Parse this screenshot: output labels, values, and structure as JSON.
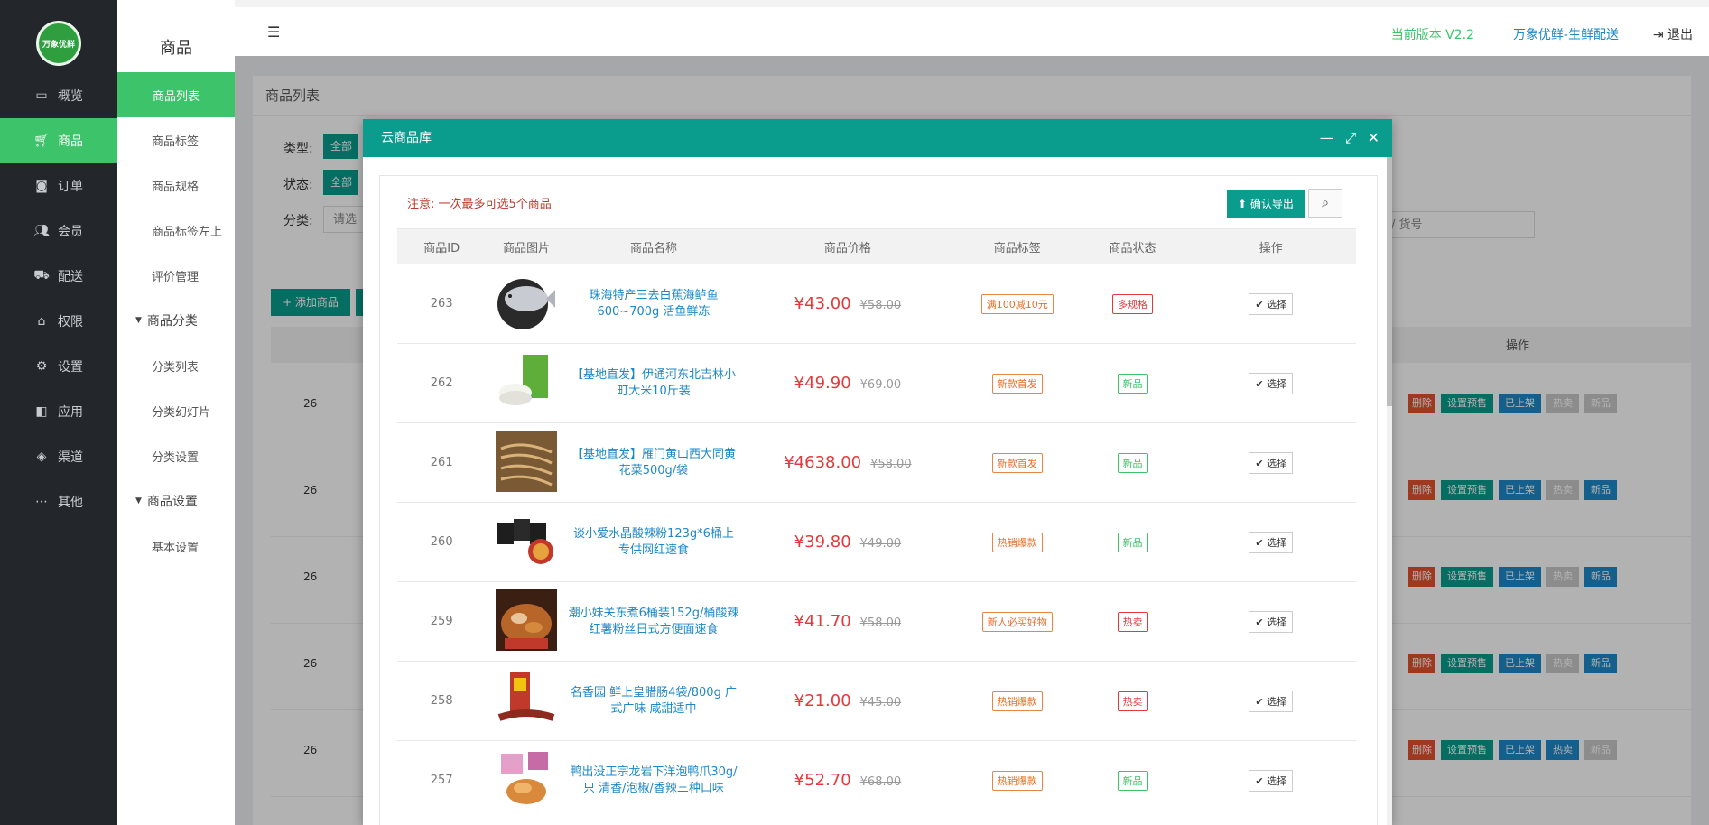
{
  "brand": {
    "logo_text": "万象优鲜"
  },
  "header": {
    "version": "当前版本 V2.2",
    "store": "万象优鲜-生鲜配送",
    "logout": "退出"
  },
  "sidebar": {
    "items": [
      {
        "label": "概览",
        "icon": "monitor-icon"
      },
      {
        "label": "商品",
        "icon": "cart-icon"
      },
      {
        "label": "订单",
        "icon": "money-icon"
      },
      {
        "label": "会员",
        "icon": "users-icon"
      },
      {
        "label": "配送",
        "icon": "truck-icon"
      },
      {
        "label": "权限",
        "icon": "bank-icon"
      },
      {
        "label": "设置",
        "icon": "sitemap-icon"
      },
      {
        "label": "应用",
        "icon": "apps-icon"
      },
      {
        "label": "渠道",
        "icon": "cube-icon"
      },
      {
        "label": "其他",
        "icon": "dots-icon"
      }
    ]
  },
  "subnav": {
    "title": "商品",
    "items": [
      "商品列表",
      "商品标签",
      "商品规格",
      "商品标签左上",
      "评价管理"
    ],
    "group1": "商品分类",
    "group1_items": [
      "分类列表",
      "分类幻灯片",
      "分类设置"
    ],
    "group2": "商品设置",
    "group2_items": [
      "基本设置"
    ]
  },
  "page": {
    "card_title": "商品列表",
    "filter_type": "类型:",
    "filter_status": "状态:",
    "filter_category": "分类:",
    "filter_all": "全部",
    "filter_select": "请选",
    "search_hint": "/ 货号",
    "add_button": "+ 添加商品",
    "op_header": "操作",
    "row_ids": [
      "26",
      "26",
      "26",
      "26",
      "26"
    ],
    "row_buttons": [
      "删除",
      "设置预售",
      "已上架",
      "热卖",
      "新品"
    ]
  },
  "modal": {
    "title": "云商品库",
    "notice": "注意:  一次最多可选5个商品",
    "export_button": "确认导出",
    "columns": [
      "商品ID",
      "商品图片",
      "商品名称",
      "商品价格",
      "商品标签",
      "商品状态",
      "操作"
    ],
    "select_label": "选择",
    "rows": [
      {
        "id": "263",
        "name": "珠海特产三去白蕉海鲈鱼600~700g 活鱼鲜冻",
        "price": "¥43.00",
        "old_price": "¥58.00",
        "tag": "满100减10元",
        "status": "多规格",
        "status_color": "#e4393c"
      },
      {
        "id": "262",
        "name": "【基地直发】伊通河东北吉林小町大米10斤装",
        "price": "¥49.90",
        "old_price": "¥69.00",
        "tag": "新款首发",
        "status": "新品",
        "status_color": "#3dc36a"
      },
      {
        "id": "261",
        "name": "【基地直发】雁门黄山西大同黄花菜500g/袋",
        "price": "¥4638.00",
        "old_price": "¥58.00",
        "tag": "新款首发",
        "status": "新品",
        "status_color": "#3dc36a"
      },
      {
        "id": "260",
        "name": "谈小爱水晶酸辣粉123g*6桶上专供网红速食",
        "price": "¥39.80",
        "old_price": "¥49.00",
        "tag": "热销爆款",
        "status": "新品",
        "status_color": "#3dc36a"
      },
      {
        "id": "259",
        "name": "潮小妹关东煮6桶装152g/桶酸辣红薯粉丝日式方便面速食",
        "price": "¥41.70",
        "old_price": "¥58.00",
        "tag": "新人必买好物",
        "status": "热卖",
        "status_color": "#e4393c"
      },
      {
        "id": "258",
        "name": "名香园 鲜上皇腊肠4袋/800g 广式广味 咸甜适中",
        "price": "¥21.00",
        "old_price": "¥45.00",
        "tag": "热销爆款",
        "status": "热卖",
        "status_color": "#e4393c"
      },
      {
        "id": "257",
        "name": "鸭出没正宗龙岩下洋泡鸭爪30g/只 清香/泡椒/香辣三种口味",
        "price": "¥52.70",
        "old_price": "¥68.00",
        "tag": "热销爆款",
        "status": "新品",
        "status_color": "#3dc36a"
      }
    ]
  }
}
